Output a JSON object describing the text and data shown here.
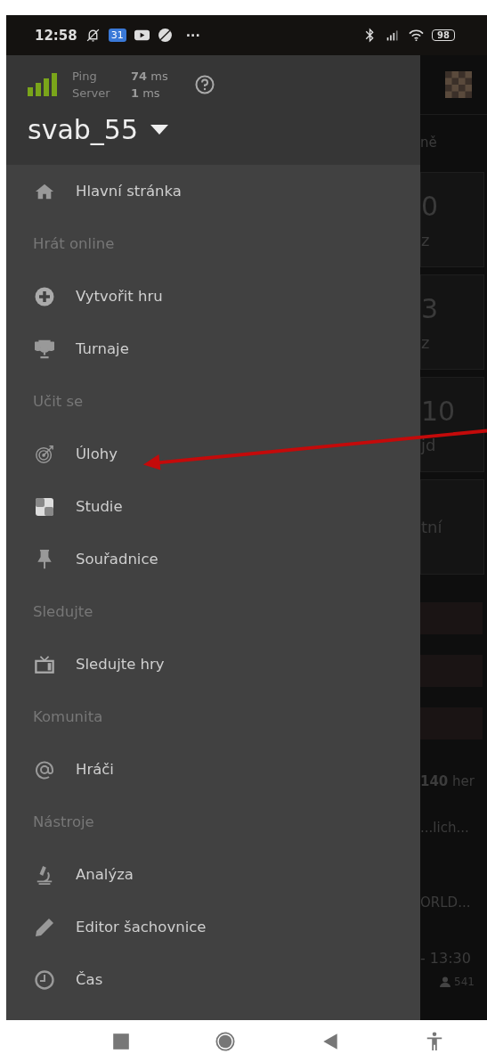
{
  "status_bar": {
    "time": "12:58",
    "calendar_badge": "31",
    "more": "···",
    "battery": "98"
  },
  "drawer": {
    "connection": {
      "ping_label": "Ping",
      "ping_value": "**74** ms",
      "server_label": "Server",
      "server_value": "**1** ms"
    },
    "username": "svab_55",
    "menu": [
      {
        "kind": "link",
        "label": "Hlavní stránka"
      },
      {
        "kind": "section",
        "label": "Hrát online"
      },
      {
        "kind": "link",
        "label": "Vytvořit hru"
      },
      {
        "kind": "link",
        "label": "Turnaje"
      },
      {
        "kind": "section",
        "label": "Učit se"
      },
      {
        "kind": "link",
        "label": "Úlohy"
      },
      {
        "kind": "link",
        "label": "Studie"
      },
      {
        "kind": "link",
        "label": "Souřadnice"
      },
      {
        "kind": "section",
        "label": "Sledujte"
      },
      {
        "kind": "link",
        "label": "Sledujte hry"
      },
      {
        "kind": "section",
        "label": "Komunita"
      },
      {
        "kind": "link",
        "label": "Hráči"
      },
      {
        "kind": "section",
        "label": "Nástroje"
      },
      {
        "kind": "link",
        "label": "Analýza"
      },
      {
        "kind": "link",
        "label": "Editor šachovnice"
      },
      {
        "kind": "link",
        "label": "Čas"
      }
    ]
  },
  "background_page": {
    "tab_fragment": "ně",
    "cards": [
      {
        "value": "0",
        "caption": "z"
      },
      {
        "value": "3",
        "caption": "z"
      },
      {
        "value": "10",
        "caption": "jd"
      },
      {
        "caption": "tní"
      }
    ],
    "game_count": "**140** her",
    "fragment_1": "...lich...",
    "fragment_2": "ORLD...",
    "time_fragment": "- 13:30",
    "players": "541"
  }
}
